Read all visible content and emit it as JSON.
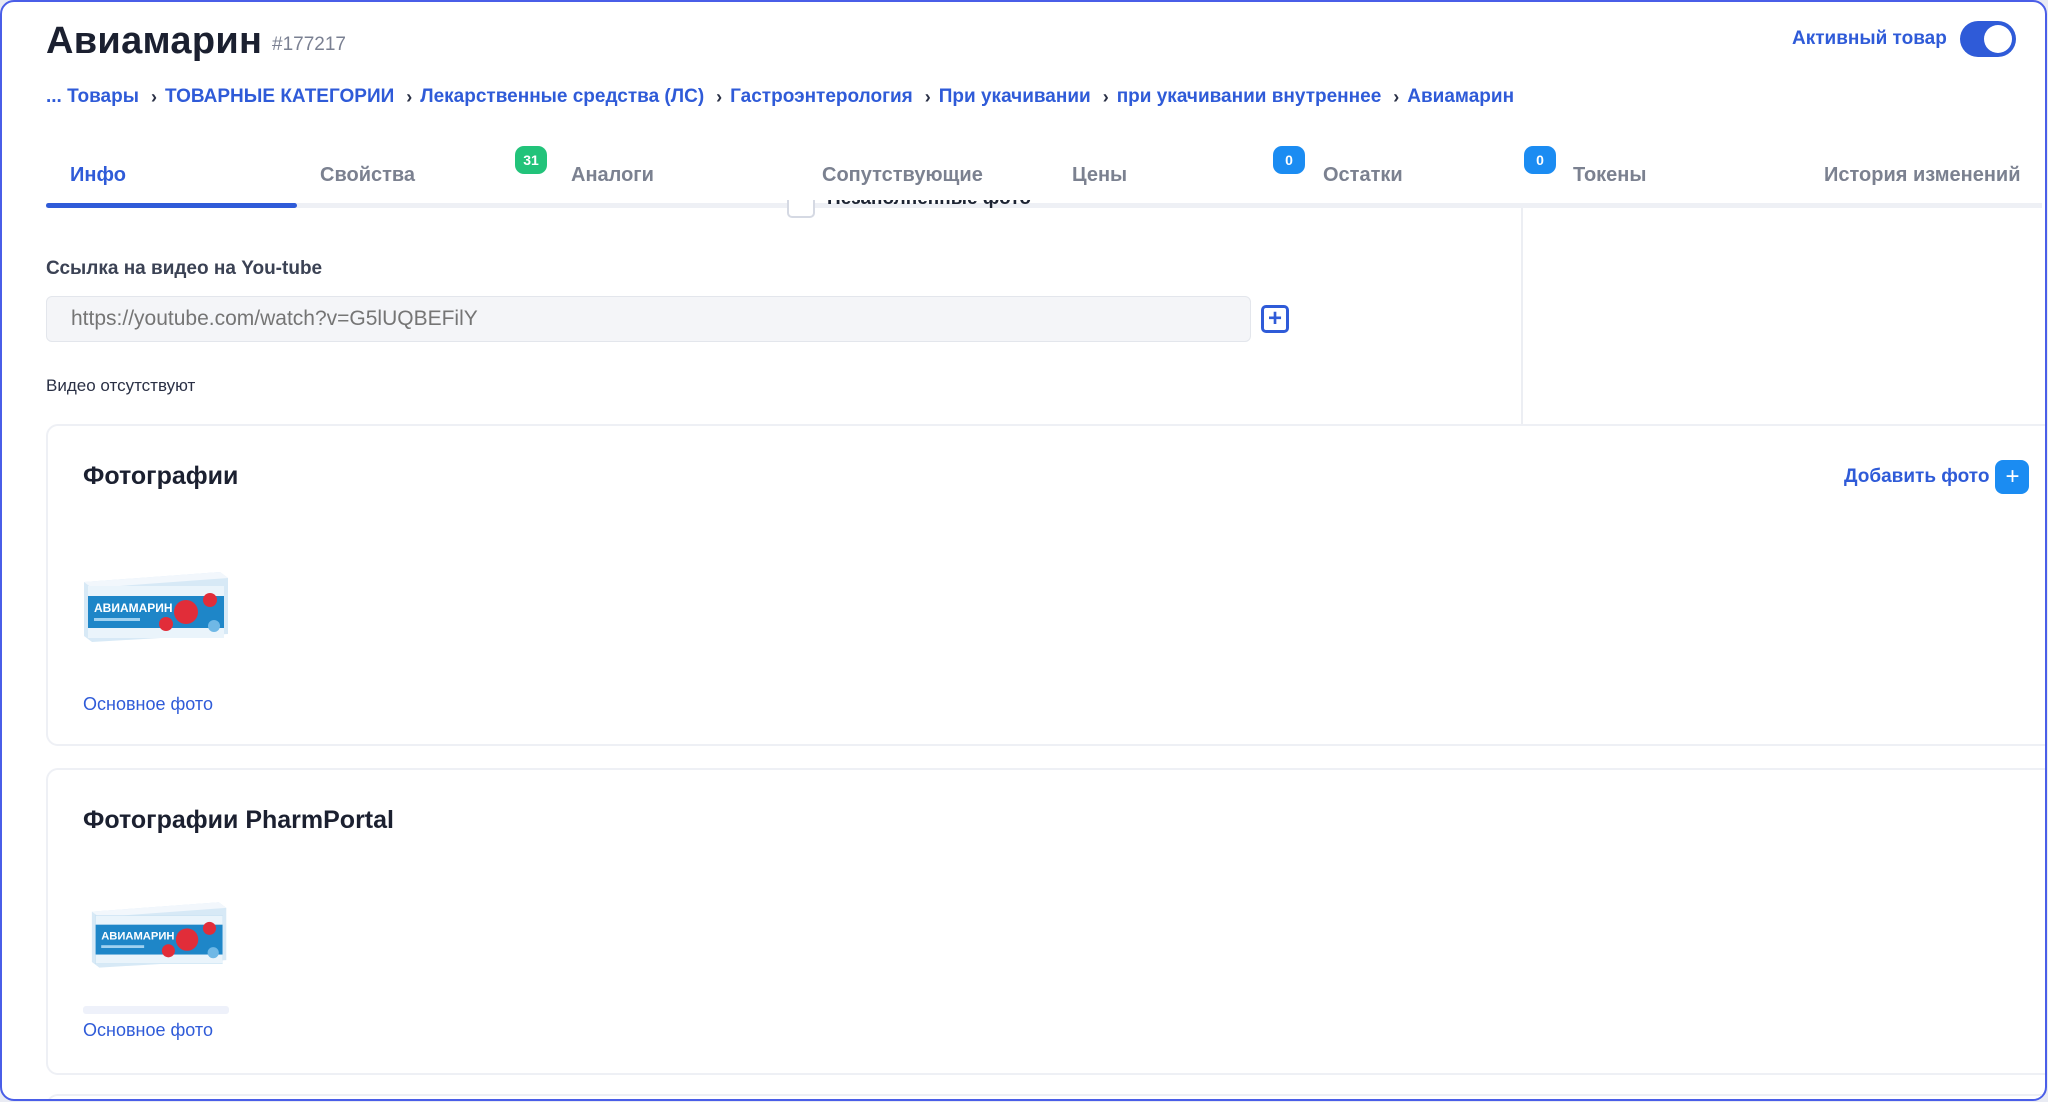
{
  "header": {
    "title": "Авиамарин",
    "product_id": "#177217",
    "active_label": "Активный товар",
    "active": true
  },
  "breadcrumb": [
    "... Товары",
    "ТОВАРНЫЕ КАТЕГОРИИ",
    "Лекарственные средства (ЛС)",
    "Гастроэнтерология",
    "При укачивании",
    "при укачивании внутреннее",
    "Авиамарин"
  ],
  "tabs": [
    {
      "label": "Инфо",
      "active": true
    },
    {
      "label": "Свойства"
    },
    {
      "label": "Аналоги",
      "badge": "31"
    },
    {
      "label": "Сопутствующие"
    },
    {
      "label": "Цены"
    },
    {
      "label": "Остатки",
      "badge": "0"
    },
    {
      "label": "Токены",
      "badge": "0"
    },
    {
      "label": "История изменений"
    }
  ],
  "unlinked_photos_label": "Незаполненные фото",
  "video": {
    "label": "Ссылка на видео на You-tube",
    "placeholder": "https://youtube.com/watch?v=G5lUQBEFilY",
    "empty_text": "Видео отсутствуют"
  },
  "photos": {
    "title": "Фотографии",
    "add_label": "Добавить фото",
    "caption": "Основное фото",
    "package_brand": "АВИАМАРИН"
  },
  "pharm_photos": {
    "title": "Фотографии PharmPortal",
    "caption": "Основное фото",
    "package_brand": "АВИАМАРИН"
  },
  "colors": {
    "accent": "#2f5bd8",
    "badge_green": "#22c37a",
    "badge_blue": "#1b8cf2"
  }
}
